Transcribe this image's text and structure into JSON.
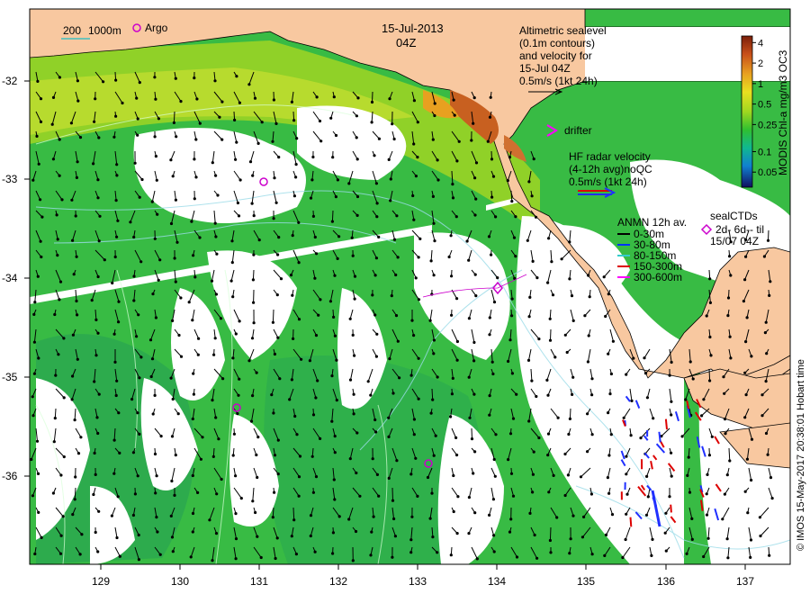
{
  "title": {
    "date": "15-Jul-2013",
    "time": "04Z"
  },
  "scale_bar": {
    "label_a": "200",
    "label_b": "1000m"
  },
  "argo_legend": {
    "label": "Argo"
  },
  "sealevel_legend": {
    "line1": "Altimetric sealevel",
    "line2": "(0.1m contours)",
    "line3": "and velocity for",
    "line4": "15-Jul 04Z",
    "line5": "0.5m/s (1kt 24h)"
  },
  "drifter_legend": {
    "label": "drifter"
  },
  "hf_legend": {
    "line1": "HF radar velocity",
    "line2": "(4-12h avg)noQC",
    "line3": "0.5m/s (1kt 24h)"
  },
  "anmn_legend": {
    "title": "ANMN 12h av.",
    "items": [
      {
        "label": "0-30m",
        "color": "#000000"
      },
      {
        "label": "30-80m",
        "color": "#0033ff"
      },
      {
        "label": "80-150m",
        "color": "#33cccc"
      },
      {
        "label": "150-300m",
        "color": "#dd0000"
      },
      {
        "label": "300-600m",
        "color": "#ff00ff"
      }
    ]
  },
  "sealctd_legend": {
    "title": "sealCTDs",
    "line1": "2d- 6d-- til",
    "line2": "15/07 04Z"
  },
  "colorbar": {
    "title": "MODIS Chl-a mg/m3 OC3",
    "scale": "log",
    "ticks": [
      "4",
      "2",
      "1",
      "0.5",
      "0.25",
      "0.1",
      "0.05"
    ],
    "colors": [
      "#7a1f0a",
      "#c8501a",
      "#e8a020",
      "#e8e020",
      "#a0d820",
      "#30c030",
      "#10b890",
      "#1080d0",
      "#1030a0",
      "#101060"
    ]
  },
  "axes": {
    "x_ticks": [
      "129",
      "130",
      "131",
      "132",
      "133",
      "134",
      "135",
      "136",
      "137"
    ],
    "y_ticks": [
      "-32",
      "-33",
      "-34",
      "-35",
      "-36"
    ]
  },
  "credit": "© IMOS 15-May-2017 20:38:01 Hobart time",
  "colors": {
    "land": "#f8c8a0",
    "ocean_green": "#40c040",
    "ocean_yellowgreen": "#a0d820",
    "argo": "#cc00cc",
    "drifter": "#ff00ff",
    "hf_red": "#dd0000",
    "hf_blue": "#2030ff"
  }
}
